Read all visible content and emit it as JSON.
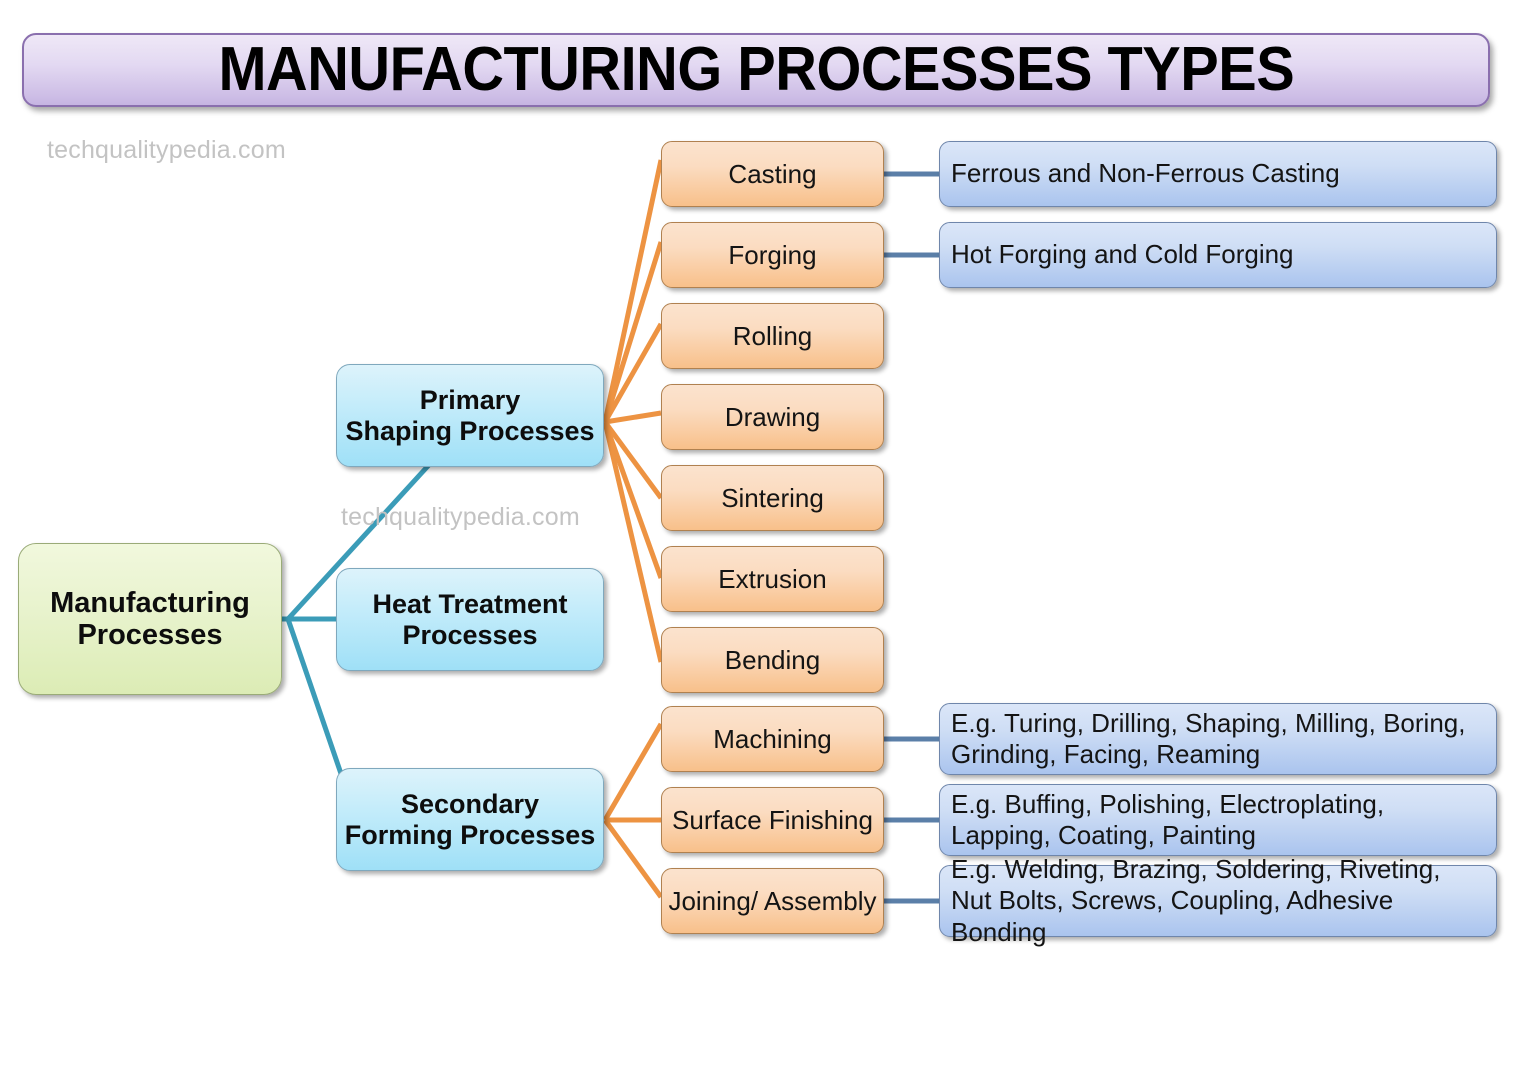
{
  "title": {
    "text": "MANUFACTURING PROCESSES TYPES"
  },
  "watermarks": [
    {
      "text": "techqualitypedia.com"
    },
    {
      "text": "techqualitypedia.com"
    }
  ],
  "colors": {
    "title_fill": "#d5c6ea",
    "title_border": "#8a6fae",
    "root_fill": "#e4efc8",
    "root_border": "#9aab78",
    "branch_fill": "#b5e7f8",
    "branch_border": "#7fa8bd",
    "process_fill": "#f9cfa6",
    "process_border": "#b08150",
    "detail_fill": "#c3d6f2",
    "detail_border": "#6f86ab",
    "connector_root": "#3b9cb8",
    "connector_process": "#ed9342",
    "connector_detail": "#5b7fa8",
    "watermark": "#c3c3c3"
  },
  "root": {
    "label": "Manufacturing\nProcesses"
  },
  "branches": [
    {
      "id": "primary",
      "label": "Primary\nShaping Processes"
    },
    {
      "id": "heat",
      "label": "Heat Treatment\nProcesses"
    },
    {
      "id": "secondary",
      "label": "Secondary\nForming Processes"
    }
  ],
  "processes": [
    {
      "id": "casting",
      "parent": "primary",
      "label": "Casting"
    },
    {
      "id": "forging",
      "parent": "primary",
      "label": "Forging"
    },
    {
      "id": "rolling",
      "parent": "primary",
      "label": "Rolling"
    },
    {
      "id": "drawing",
      "parent": "primary",
      "label": "Drawing"
    },
    {
      "id": "sintering",
      "parent": "primary",
      "label": "Sintering"
    },
    {
      "id": "extrusion",
      "parent": "primary",
      "label": "Extrusion"
    },
    {
      "id": "bending",
      "parent": "primary",
      "label": "Bending"
    },
    {
      "id": "machining",
      "parent": "secondary",
      "label": "Machining"
    },
    {
      "id": "surface",
      "parent": "secondary",
      "label": "Surface Finishing"
    },
    {
      "id": "joining",
      "parent": "secondary",
      "label": "Joining/ Assembly"
    }
  ],
  "details": [
    {
      "id": "casting-detail",
      "parent": "casting",
      "label": "Ferrous and Non-Ferrous Casting"
    },
    {
      "id": "forging-detail",
      "parent": "forging",
      "label": "Hot Forging and Cold Forging"
    },
    {
      "id": "machining-detail",
      "parent": "machining",
      "label": "E.g. Turing, Drilling, Shaping, Milling, Boring, Grinding, Facing, Reaming"
    },
    {
      "id": "surface-detail",
      "parent": "surface",
      "label": "E.g. Buffing, Polishing, Electroplating, Lapping, Coating, Painting"
    },
    {
      "id": "joining-detail",
      "parent": "joining",
      "label": "E.g. Welding, Brazing, Soldering, Riveting, Nut Bolts,  Screws,  Coupling, Adhesive Bonding"
    }
  ]
}
